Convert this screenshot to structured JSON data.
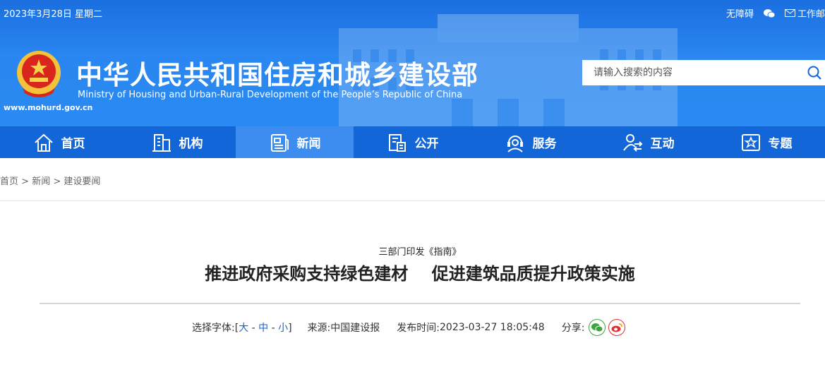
{
  "topbar": {
    "date": "2023年3月28日 星期二",
    "accessibility": "无障碍",
    "mail": "工作邮"
  },
  "header": {
    "title_cn": "中华人民共和国住房和城乡建设部",
    "title_en": "Ministry of Housing and Urban-Rural Development of the People’s Republic of China",
    "url": "www.mohurd.gov.cn",
    "search_placeholder": "请输入搜索的内容"
  },
  "nav": {
    "items": [
      {
        "label": "首页",
        "icon": "home-icon"
      },
      {
        "label": "机构",
        "icon": "building-icon"
      },
      {
        "label": "新闻",
        "icon": "news-icon",
        "active": true
      },
      {
        "label": "公开",
        "icon": "document-icon"
      },
      {
        "label": "服务",
        "icon": "service-icon"
      },
      {
        "label": "互动",
        "icon": "interaction-icon"
      },
      {
        "label": "专题",
        "icon": "star-icon"
      }
    ],
    "active_color": "#3d8cf0",
    "bar_color": "#1266d8"
  },
  "breadcrumb": {
    "items": [
      "首页",
      "新闻",
      "建设要闻"
    ],
    "separator": ">"
  },
  "article": {
    "subtitle": "三部门印发《指南》",
    "title": "推进政府采购支持绿色建材    促进建筑品质提升政策实施",
    "font_select_label": "选择字体:",
    "font_sizes": [
      "大",
      "中",
      "小"
    ],
    "source_label": "来源:",
    "source": "中国建设报",
    "publish_label": "发布时间:",
    "publish_time": "2023-03-27 18:05:48",
    "share_label": "分享:"
  }
}
